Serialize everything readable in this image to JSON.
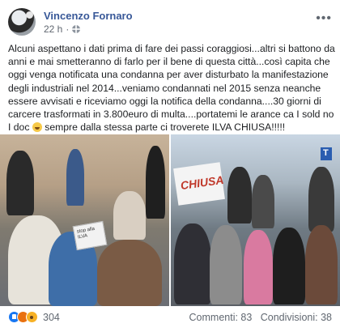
{
  "header": {
    "author": "Vincenzo Fornaro",
    "time": "22 h",
    "separator": "·",
    "menu_glyph": "•••"
  },
  "post": {
    "text_main": "Alcuni aspettano i dati prima di fare dei passi coraggiosi...altri si battono da anni e mai smetteranno di farlo per il bene di questa città...così capita che oggi venga notificata una condanna per aver disturbato la manifestazione degli industriali nel 2014...veniamo condannati nel 2015 senza neanche essere avvisati e riceviamo oggi la notifica della condanna....30 giorni di carcere trasformati in 3.800euro di multa....portatemi le arance ca I sold no I doc",
    "text_tail": "sempre dalla stessa parte ci troverete ILVA CHIUSA!!!!!"
  },
  "photos": {
    "left_sign_text": "stop alla ILVA",
    "right_banner_text": "CHIUSA",
    "right_street_sign": "T"
  },
  "footer": {
    "reaction_icons": [
      "like-icon",
      "angry-icon",
      "wow-icon"
    ],
    "reaction_count": "304",
    "comments": "Commenti: 83",
    "shares": "Condivisioni: 38"
  },
  "colors": {
    "author": "#385898",
    "muted": "#606770",
    "like": "#1877f2"
  }
}
